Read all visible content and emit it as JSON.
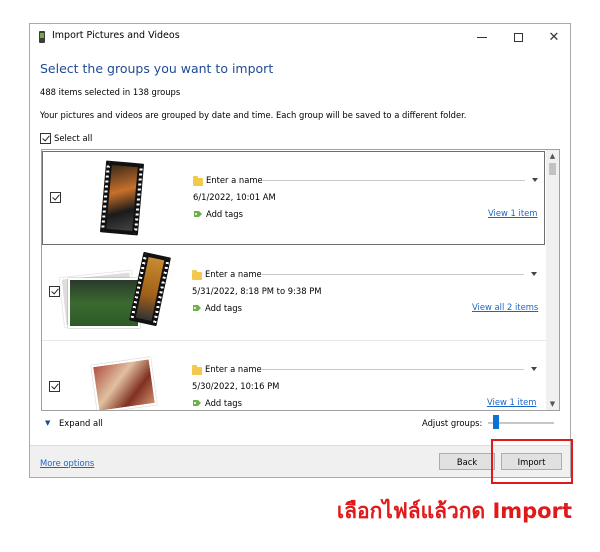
{
  "window": {
    "title": "Import Pictures and Videos",
    "buttons": {
      "minimize": "minimize",
      "maximize": "maximize",
      "close": "✕"
    }
  },
  "heading": "Select the groups you want to import",
  "items_count": "488 items selected in 138 groups",
  "description": "Your pictures and videos are grouped by date and time. Each group will be saved to a different folder.",
  "select_all": {
    "label": "Select all",
    "checked": true
  },
  "groups": [
    {
      "name_placeholder": "Enter a name",
      "date": "6/1/2022, 10:01 AM",
      "tags": "Add tags",
      "view": "View 1 item",
      "checked": true
    },
    {
      "name_placeholder": "Enter a name",
      "date": "5/31/2022, 8:18 PM to 9:38 PM",
      "tags": "Add tags",
      "view": "View all 2 items",
      "checked": true
    },
    {
      "name_placeholder": "Enter a name",
      "date": "5/30/2022, 10:16 PM",
      "tags": "Add tags",
      "view": "View 1 item",
      "checked": true
    }
  ],
  "expand_all": "Expand all",
  "adjust_groups": {
    "label": "Adjust groups:",
    "level": 0.1
  },
  "footer": {
    "more_options": "More options",
    "back": "Back",
    "import": "Import"
  },
  "annotation": {
    "caption": "เลือกไฟล์แล้วกด Import",
    "color": "#e01a1a"
  },
  "colors": {
    "heading": "#1e4a94",
    "link": "#1a66c8",
    "slider": "#0a72d6"
  },
  "icons": [
    "app-icon",
    "folder-icon",
    "tag-icon",
    "chevron-down-icon",
    "checkbox-checked-icon"
  ]
}
